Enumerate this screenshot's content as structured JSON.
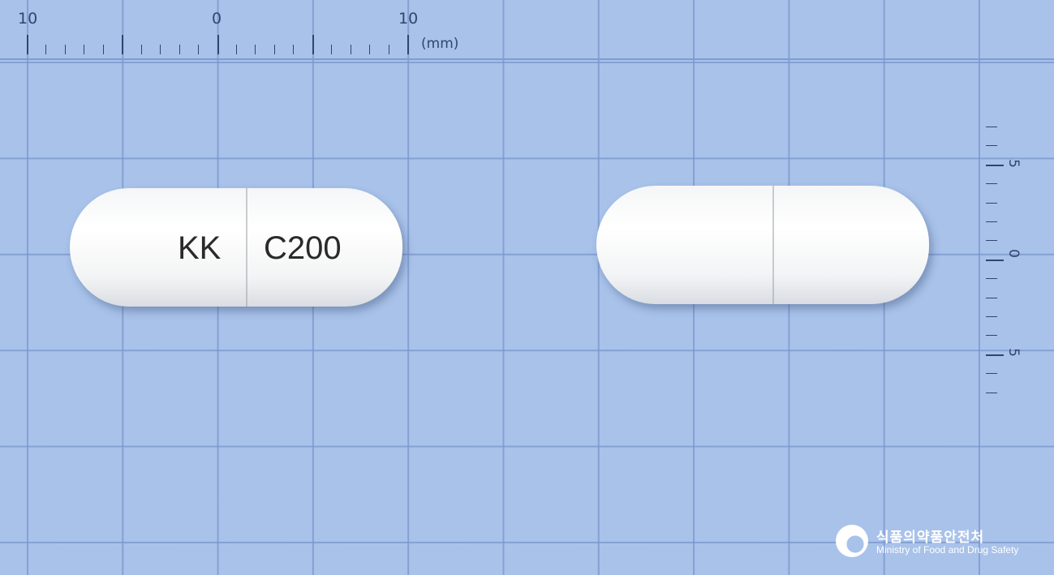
{
  "ruler": {
    "top_labels": [
      "10",
      "0",
      "10"
    ],
    "unit": "(mm)",
    "right_labels": [
      "5",
      "0",
      "5"
    ]
  },
  "pill_front": {
    "imprint_left": "KK",
    "imprint_right": "C200"
  },
  "logo": {
    "name_ko": "식품의약품안전처",
    "name_en": "Ministry of Food and Drug Safety"
  },
  "colors": {
    "background": "#a8c2ea",
    "capsule": "#ffffff",
    "ruler": "#2f4670"
  }
}
